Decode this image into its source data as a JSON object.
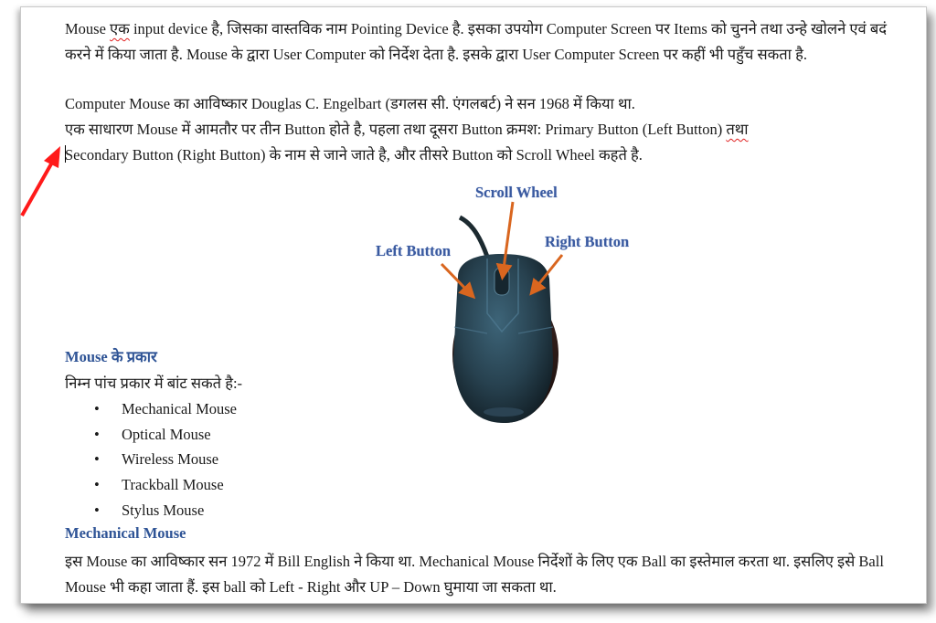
{
  "document": {
    "paragraph1": {
      "before_squiggle": "Mouse ",
      "squiggle_word": "एक",
      "after_squiggle": " input device है, जिसका वास्तविक नाम Pointing Device है. इसका उपयोग Computer Screen पर Items को चुनने तथा उन्हे खोलने एवं बदं करने में किया जाता है. Mouse के द्वारा User Computer को निर्देश देता है. इसके द्वारा User Computer Screen पर कहीं भी पहुँच सकता है."
    },
    "paragraph2": "Computer Mouse का आविष्कार Douglas C. Engelbart (डगलस सी. एंगलबर्ट) ने सन 1968 में किया था.",
    "paragraph3": {
      "line1_before": "एक साधारण Mouse में आमतौर पर तीन Button होते है, पहला तथा दूसरा Button क्रमश: Primary Button (Left Button) ",
      "line1_squiggle": "तथा",
      "line2": "Secondary Button (Right Button) के नाम से जाने जाते है, और तीसरे Button को Scroll Wheel कहते है."
    },
    "figure": {
      "label_scroll": "Scroll Wheel",
      "label_left": "Left Button",
      "label_right": "Right Button",
      "arrow_color": "#d9661f",
      "label_color": "#3a5aa0"
    },
    "section_types": {
      "heading": "Mouse के प्रकार",
      "intro": "निम्न पांच प्रकार में बांट सकते है:-",
      "bullet": "•",
      "items": [
        "Mechanical Mouse",
        "Optical Mouse",
        "Wireless Mouse",
        "Trackball Mouse",
        "Stylus Mouse"
      ]
    },
    "section_mechanical": {
      "heading": "Mechanical Mouse",
      "body": "इस Mouse का आविष्कार सन 1972 में Bill English ने किया था. Mechanical Mouse निर्देशों के लिए एक Ball का इस्तेमाल करता था. इसलिए इसे Ball Mouse भी कहा जाता हैं. इस ball को Left - Right और UP – Down घुमाया जा सकता था."
    },
    "colors": {
      "heading": "#2f5496",
      "annotation_arrow": "#ff1a1a",
      "spellcheck": "#e02020"
    }
  }
}
